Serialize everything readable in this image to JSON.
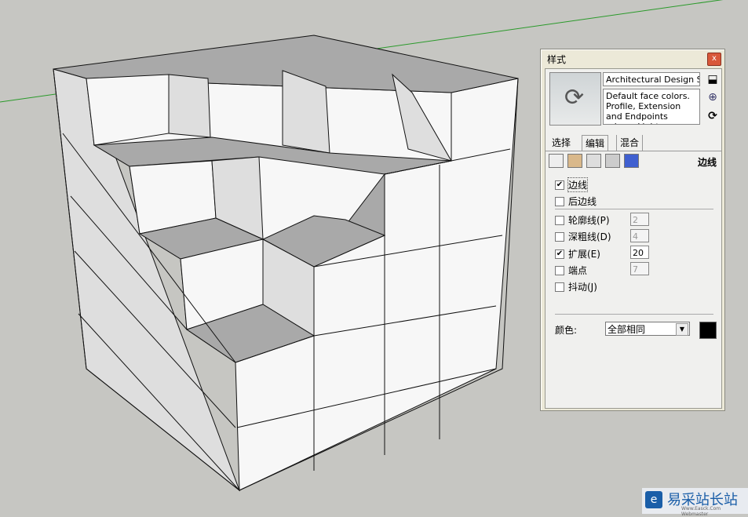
{
  "scene": {
    "face_color": "#f7f7f7",
    "side_color": "#dedede",
    "top_color": "#a9a9a9",
    "axis_green": "#2a9a2a"
  },
  "panel": {
    "title": "样式",
    "close_label": "x",
    "style_name": "Architectural Design Style",
    "style_description": "Default face colors. Profile, Extension and Endpoints edges. Light",
    "side_icons": [
      "create-style-icon",
      "update-style-icon",
      "refresh-icon"
    ],
    "tabs": [
      {
        "label": "选择"
      },
      {
        "label": "编辑",
        "active": true
      },
      {
        "label": "混合"
      }
    ],
    "edit_icons": [
      "edge-settings-icon",
      "face-settings-icon",
      "background-settings-icon",
      "watermark-settings-icon",
      "modeling-settings-icon"
    ],
    "section_label": "边线",
    "options": [
      {
        "label": "边线",
        "checked": true
      },
      {
        "label": "后边线",
        "checked": false
      },
      {
        "label": "轮廓线(P)",
        "checked": false,
        "value": "2"
      },
      {
        "label": "深粗线(D)",
        "checked": false,
        "value": "4"
      },
      {
        "label": "扩展(E)",
        "checked": true,
        "value": "20"
      },
      {
        "label": "端点",
        "checked": false,
        "value": "7"
      },
      {
        "label": "抖动(J)",
        "checked": false
      }
    ],
    "color_label": "颜色:",
    "color_mode": "全部相同",
    "edge_color": "#000000"
  },
  "watermark": {
    "text": "易采站长站",
    "subtext": "Www.Easck.Com Webmaster"
  }
}
